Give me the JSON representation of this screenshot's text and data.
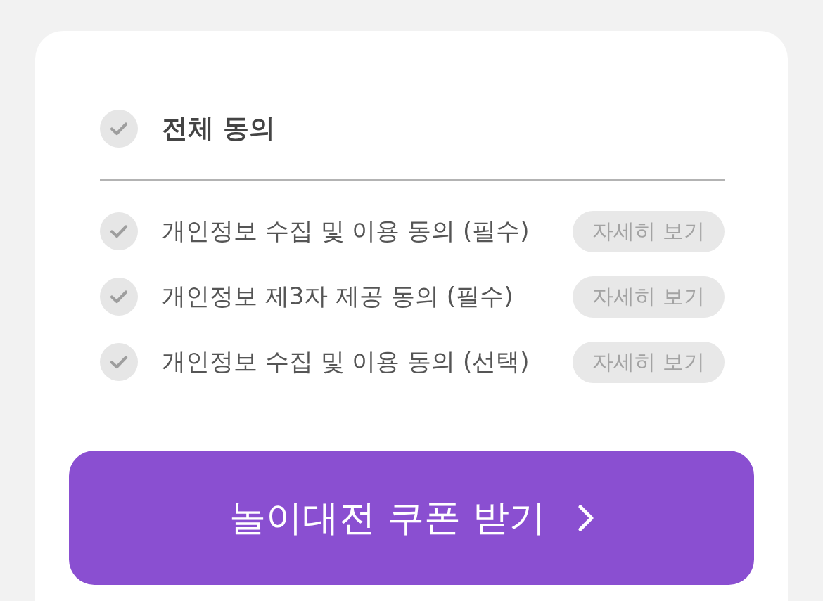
{
  "all_agree": {
    "label": "전체 동의",
    "checked": false
  },
  "agreements": [
    {
      "label": "개인정보 수집 및 이용 동의 (필수)",
      "checked": false,
      "details_button": "자세히 보기"
    },
    {
      "label": "개인정보 제3자 제공 동의 (필수)",
      "checked": false,
      "details_button": "자세히 보기"
    },
    {
      "label": "개인정보 수집 및 이용 동의 (선택)",
      "checked": false,
      "details_button": "자세히 보기"
    }
  ],
  "submit_button": {
    "label": "놀이대전 쿠폰 받기"
  }
}
